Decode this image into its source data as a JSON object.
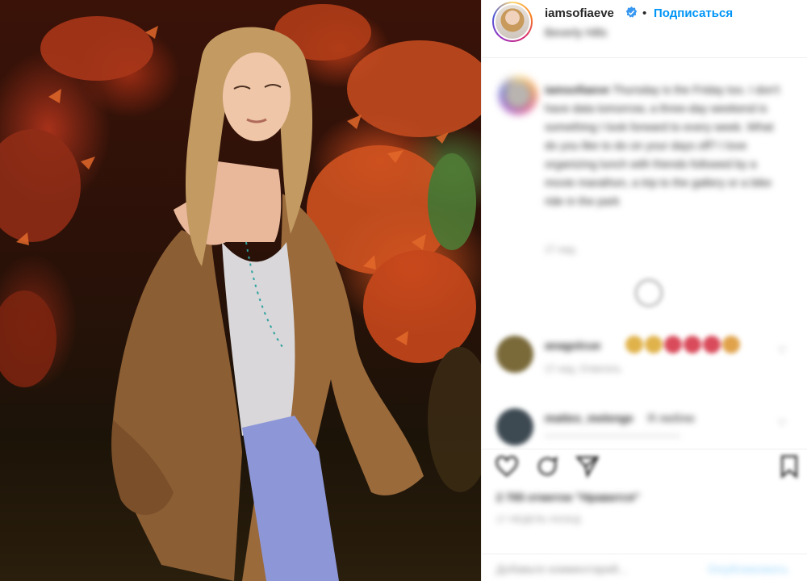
{
  "post": {
    "photo_alt": "photo",
    "header": {
      "username": "iamsofiaeve",
      "verified_icon": "verified-badge-icon",
      "separator": "•",
      "follow_label": "Подписаться",
      "location": "Beverly Hills"
    },
    "caption": {
      "username": "iamsofiaeve",
      "text": "Thursday is the Friday too. I don't have data tomorrow, a three-day weekend is something I look forward to every week. What do you like to do on your days off? I love organizing lunch with friends followed by a movie marathon, a trip to the gallery or a bike ride in the park",
      "time": "17 нед."
    },
    "comments": [
      {
        "user": "anagolcue",
        "text": "",
        "emojis": [
          "#e0b24a",
          "#e0b24a",
          "#d94a5a",
          "#d94a5a",
          "#d94a5a",
          "#e0a24a"
        ],
        "meta": "17 нед.   Ответить",
        "avatar_color": "#7a6a3a"
      },
      {
        "user": "mattes_melenge",
        "text": "Я люблю",
        "meta": "——————————————",
        "avatar_color": "#3e4a52"
      }
    ],
    "actions": {
      "like_icon": "heart-icon",
      "comment_icon": "comment-icon",
      "share_icon": "share-icon",
      "save_icon": "bookmark-icon"
    },
    "likes": "2 765 отметок \"Нравится\"",
    "date": "17 НЕДЕЛЬ НАЗАД",
    "add_comment_placeholder": "Добавьте комментарий...",
    "publish_label": "Опубликовать"
  }
}
